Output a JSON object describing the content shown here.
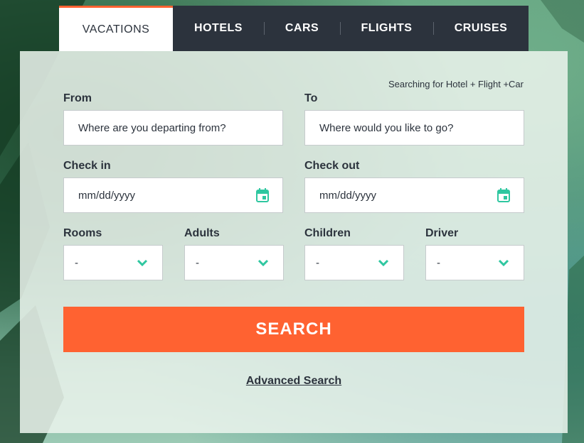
{
  "tabs": [
    {
      "label": "VACATIONS",
      "active": true
    },
    {
      "label": "HOTELS",
      "active": false
    },
    {
      "label": "CARS",
      "active": false
    },
    {
      "label": "FLIGHTS",
      "active": false
    },
    {
      "label": "CRUISES",
      "active": false
    }
  ],
  "form": {
    "note": "Searching for Hotel + Flight +Car",
    "from": {
      "label": "From",
      "placeholder": "Where are you departing from?"
    },
    "to": {
      "label": "To",
      "placeholder": "Where would you like to go?"
    },
    "check_in": {
      "label": "Check in",
      "placeholder": "mm/dd/yyyy",
      "icon": "calendar-icon"
    },
    "check_out": {
      "label": "Check out",
      "placeholder": "mm/dd/yyyy",
      "icon": "calendar-icon"
    },
    "rooms": {
      "label": "Rooms",
      "value": "-"
    },
    "adults": {
      "label": "Adults",
      "value": "-"
    },
    "children": {
      "label": "Children",
      "value": "-"
    },
    "driver": {
      "label": "Driver",
      "value": "-"
    },
    "search_label": "SEARCH",
    "advanced_label": "Advanced Search"
  },
  "colors": {
    "accent": "#ff6231",
    "tab_bar": "#2c333d",
    "icon": "#2fc7a0"
  }
}
